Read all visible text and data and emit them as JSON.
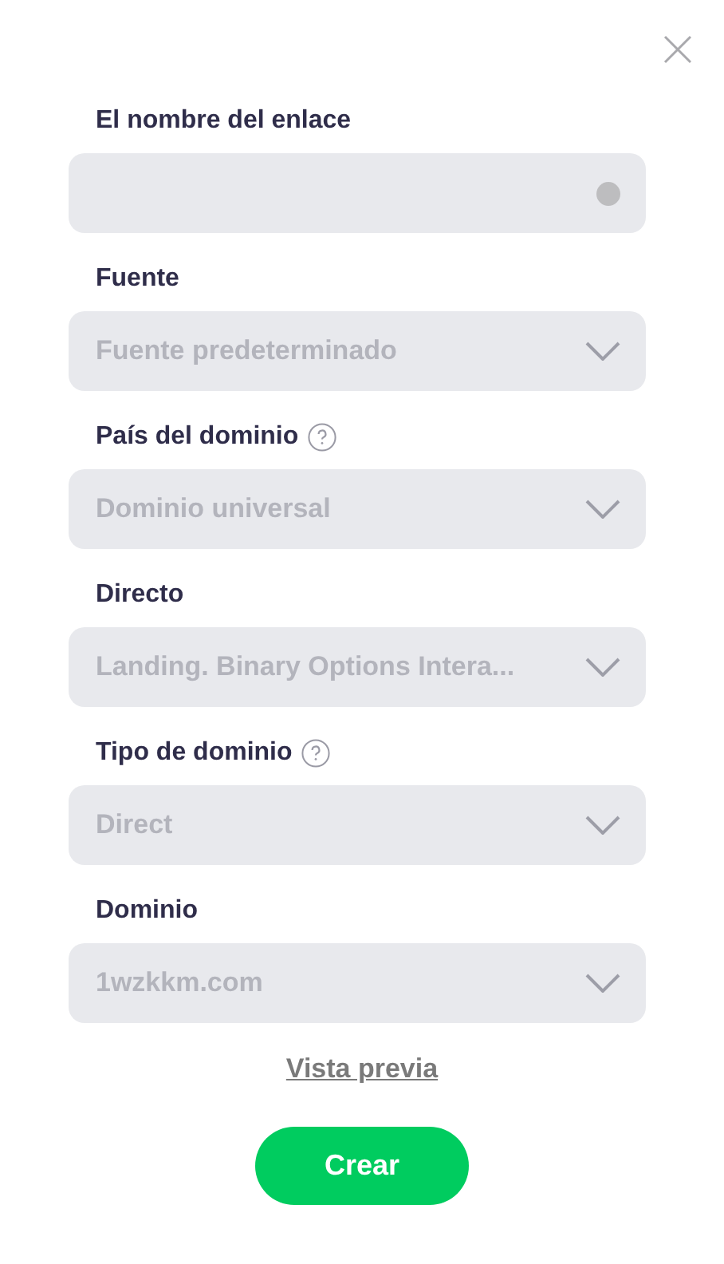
{
  "fields": [
    {
      "kind": "input",
      "label": "El nombre del enlace",
      "help": false
    },
    {
      "kind": "select",
      "label": "Fuente",
      "help": false,
      "value": "Fuente predeterminado"
    },
    {
      "kind": "select",
      "label": "País del dominio",
      "help": true,
      "value": "Dominio universal"
    },
    {
      "kind": "select",
      "label": "Directo",
      "help": false,
      "value": "Landing. Binary Options Intera..."
    },
    {
      "kind": "select",
      "label": "Tipo de dominio",
      "help": true,
      "value": "Direct"
    },
    {
      "kind": "select",
      "label": "Dominio",
      "help": false,
      "value": "1wzkkm.com"
    }
  ],
  "preview_link": "Vista previa",
  "submit_button": "Crear"
}
